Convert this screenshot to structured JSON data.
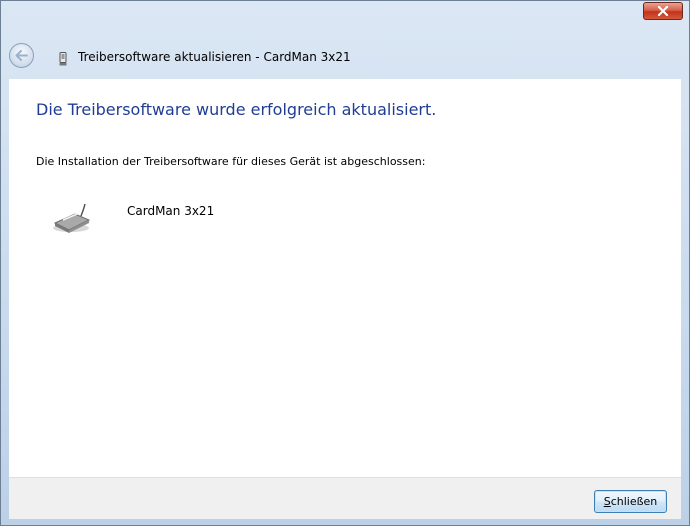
{
  "window": {
    "title": "Treibersoftware aktualisieren - CardMan 3x21"
  },
  "content": {
    "heading": "Die Treibersoftware wurde erfolgreich aktualisiert.",
    "description": "Die Installation der Treibersoftware für dieses Gerät ist abgeschlossen:",
    "device": {
      "name": "CardMan 3x21",
      "icon": "card-reader-icon"
    }
  },
  "footer": {
    "close_button": {
      "mnemonic": "S",
      "rest": "chließen"
    }
  },
  "colors": {
    "heading": "#1f3d94",
    "close_x_bg": "#c2331a",
    "button_border": "#3c7fb1"
  }
}
